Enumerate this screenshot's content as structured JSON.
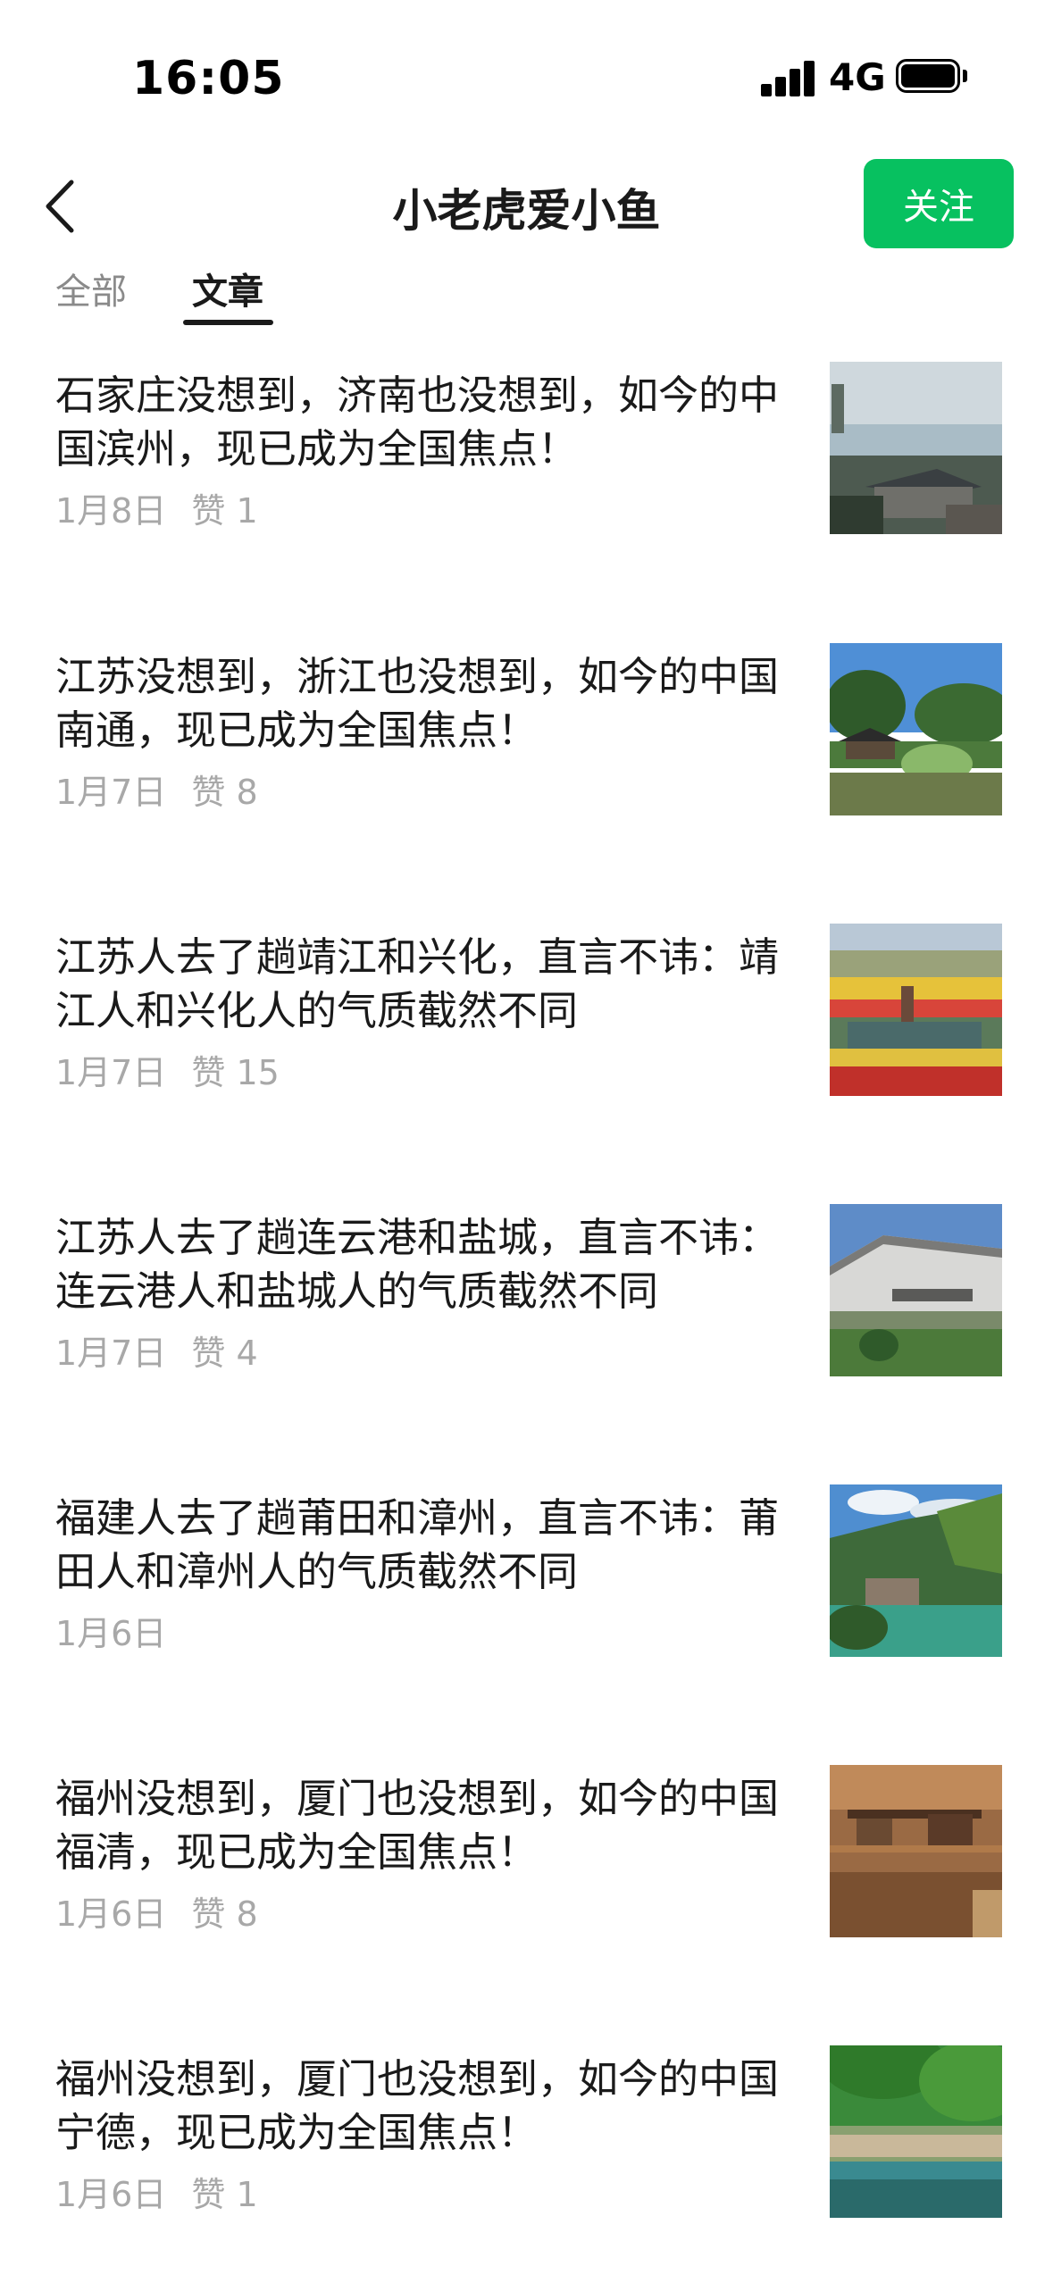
{
  "status_bar": {
    "time": "16:05",
    "network": "4G"
  },
  "header": {
    "title": "小老虎爱小鱼",
    "follow_label": "关注"
  },
  "tabs": [
    {
      "label": "全部"
    },
    {
      "label": "文章"
    }
  ],
  "articles": [
    {
      "title": "石家庄没想到，济南也没想到，如今的中国滨州，现已成为全国焦点！",
      "date": "1月8日",
      "likes": "赞 1",
      "image": "lake-pagoda-town"
    },
    {
      "title": "江苏没想到，浙江也没想到，如今的中国南通，现已成为全国焦点！",
      "date": "1月7日",
      "likes": "赞 8",
      "image": "garden-pavilion-pond"
    },
    {
      "title": "江苏人去了趟靖江和兴化，直言不讳：靖江人和兴化人的气质截然不同",
      "date": "1月7日",
      "likes": "赞 15",
      "image": "flower-fields-canal"
    },
    {
      "title": "江苏人去了趟连云港和盐城，直言不讳：连云港人和盐城人的气质截然不同",
      "date": "1月7日",
      "likes": "赞 4",
      "image": "museum-building"
    },
    {
      "title": "福建人去了趟莆田和漳州，直言不讳：莆田人和漳州人的气质截然不同",
      "date": "1月6日",
      "likes": "",
      "image": "mountain-reservoir"
    },
    {
      "title": "福州没想到，厦门也没想到，如今的中国福清，现已成为全国焦点！",
      "date": "1月6日",
      "likes": "赞 8",
      "image": "cliff-temple"
    },
    {
      "title": "福州没想到，厦门也没想到，如今的中国宁德，现已成为全国焦点！",
      "date": "1月6日",
      "likes": "赞 1",
      "image": "jungle-river-crowd"
    }
  ]
}
